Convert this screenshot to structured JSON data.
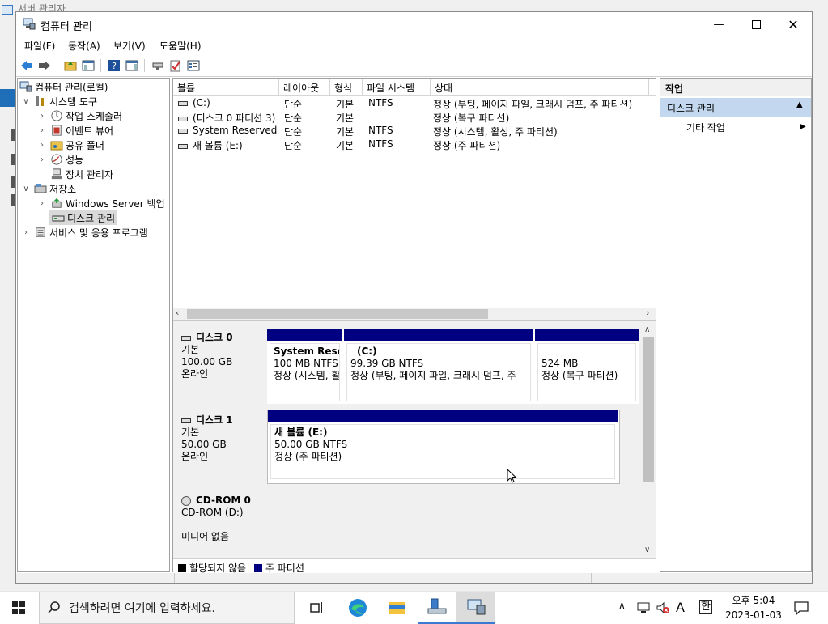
{
  "background_window": {
    "title": "서버 관리자"
  },
  "window": {
    "title": "컴퓨터 관리"
  },
  "menu": [
    "파일(F)",
    "동작(A)",
    "보기(V)",
    "도움말(H)"
  ],
  "toolbar_icons": [
    "back-icon",
    "forward-icon",
    "up-folder-icon",
    "show-hide-tree-icon",
    "help-icon",
    "action-pane-icon",
    "connect-icon",
    "check-icon",
    "properties-icon"
  ],
  "tree": {
    "root": "컴퓨터 관리(로컬)",
    "system_tools": "시스템 도구",
    "task_scheduler": "작업 스케줄러",
    "event_viewer": "이벤트 뷰어",
    "shared_folders": "공유 폴더",
    "performance": "성능",
    "device_manager": "장치 관리자",
    "storage": "저장소",
    "windows_backup": "Windows Server 백업",
    "disk_management": "디스크 관리",
    "services": "서비스 및 응용 프로그램"
  },
  "volume_list": {
    "headers": [
      "볼륨",
      "레이아웃",
      "형식",
      "파일 시스템",
      "상태"
    ],
    "rows": [
      {
        "volume": "(C:)",
        "layout": "단순",
        "type": "기본",
        "fs": "NTFS",
        "status": "정상 (부팅, 페이지 파일, 크래시 덤프, 주 파티션)"
      },
      {
        "volume": "(디스크 0 파티션 3)",
        "layout": "단순",
        "type": "기본",
        "fs": "",
        "status": "정상 (복구 파티션)"
      },
      {
        "volume": "System Reserved",
        "layout": "단순",
        "type": "기본",
        "fs": "NTFS",
        "status": "정상 (시스템, 활성, 주 파티션)"
      },
      {
        "volume": "새 볼륨 (E:)",
        "layout": "단순",
        "type": "기본",
        "fs": "NTFS",
        "status": "정상 (주 파티션)"
      }
    ]
  },
  "disks": [
    {
      "name": "디스크 0",
      "type": "기본",
      "size": "100.00 GB",
      "state": "온라인",
      "partitions": [
        {
          "name": "System Reser",
          "size": "100 MB NTFS",
          "status": "정상 (시스템, 활"
        },
        {
          "name": "(C:)",
          "size": "99.39 GB NTFS",
          "status": "정상 (부팅, 페이지 파일, 크래시 덤프, 주"
        },
        {
          "name": "",
          "size": "524 MB",
          "status": "정상 (복구 파티션)"
        }
      ]
    },
    {
      "name": "디스크 1",
      "type": "기본",
      "size": "50.00 GB",
      "state": "온라인",
      "partitions": [
        {
          "name": "새 볼륨  (E:)",
          "size": "50.00 GB NTFS",
          "status": "정상 (주 파티션)"
        }
      ]
    },
    {
      "name": "CD-ROM 0",
      "type": "CD-ROM (D:)",
      "size": "",
      "state": "미디어 없음",
      "partitions": []
    }
  ],
  "legend": {
    "unallocated": "할당되지 않음",
    "primary": "주 파티션",
    "unallocated_color": "#000000",
    "primary_color": "#000080"
  },
  "actions": {
    "header": "작업",
    "section": "디스크 관리",
    "more": "기타 작업"
  },
  "taskbar": {
    "search_placeholder": "검색하려면 여기에 입력하세요.",
    "apps": [
      "task-view-icon",
      "edge-icon",
      "file-explorer-icon",
      "server-manager-icon",
      "computer-management-icon"
    ],
    "ime_mode": "A",
    "ime_lang": "한",
    "time": "오후 5:04",
    "date": "2023-01-03"
  }
}
